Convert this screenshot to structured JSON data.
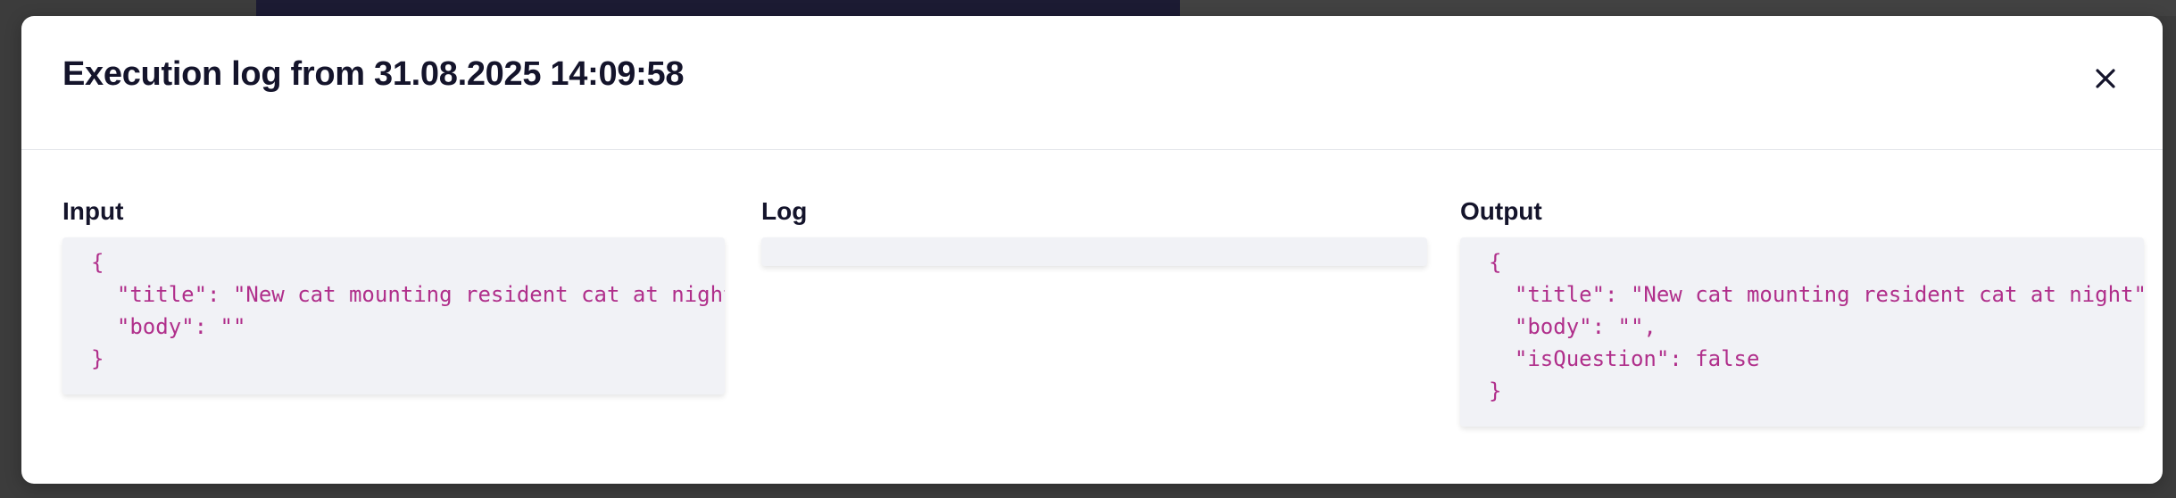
{
  "modal": {
    "title": "Execution log from 31.08.2025 14:09:58",
    "close_icon": "close-icon"
  },
  "panels": {
    "input": {
      "label": "Input",
      "lines": [
        "{",
        "  \"title\": \"New cat mounting resident cat at night\",",
        "  \"body\": \"\"",
        "}"
      ]
    },
    "log": {
      "label": "Log",
      "lines": []
    },
    "output": {
      "label": "Output",
      "lines": [
        "{",
        "  \"title\": \"New cat mounting resident cat at night\",",
        "  \"body\": \"\",",
        "  \"isQuestion\": false",
        "}"
      ]
    }
  },
  "colors": {
    "code_text": "#b02f8b",
    "title_text": "#14142b",
    "code_bg": "#f1f2f6"
  }
}
